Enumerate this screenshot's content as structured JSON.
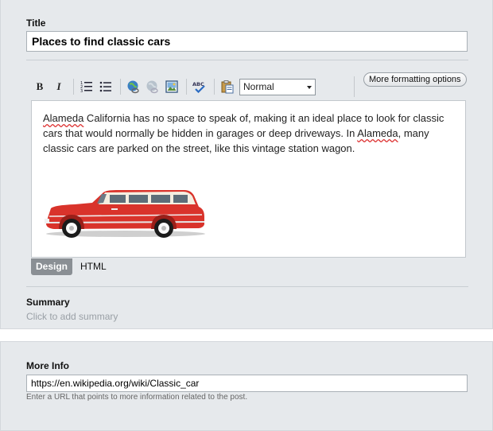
{
  "post": {
    "title_label": "Title",
    "title_value": "Places to find classic cars",
    "toolbar": {
      "bold_label": "B",
      "italic_label": "I",
      "format_value": "Normal",
      "more_formatting_label": "More formatting options",
      "icons": [
        "numbered-list-icon",
        "bullet-list-icon",
        "link-icon",
        "unlink-icon",
        "image-icon",
        "spellcheck-icon",
        "paste-icon"
      ]
    },
    "body": {
      "w1": "Alameda",
      "t1": " California has no space to speak of, making it an ideal place to look for classic cars that would normally be hidden in garages or deep driveways. In ",
      "w2": "Alameda",
      "t2": ", many classic cars are parked on the street, like this vintage station wagon."
    },
    "tabs": {
      "design_label": "Design",
      "html_label": "HTML"
    },
    "summary_label": "Summary",
    "summary_placeholder": "Click to add summary"
  },
  "more_info": {
    "label": "More Info",
    "url_value": "https://en.wikipedia.org/wiki/Classic_car",
    "help_text": "Enter a URL that points to more information related to the post."
  },
  "colors": {
    "panel_bg": "#e6e9ec",
    "active_tab_bg": "#8a8f94",
    "car_red": "#d9332b",
    "spellcheck_underline": "#dd3333"
  }
}
